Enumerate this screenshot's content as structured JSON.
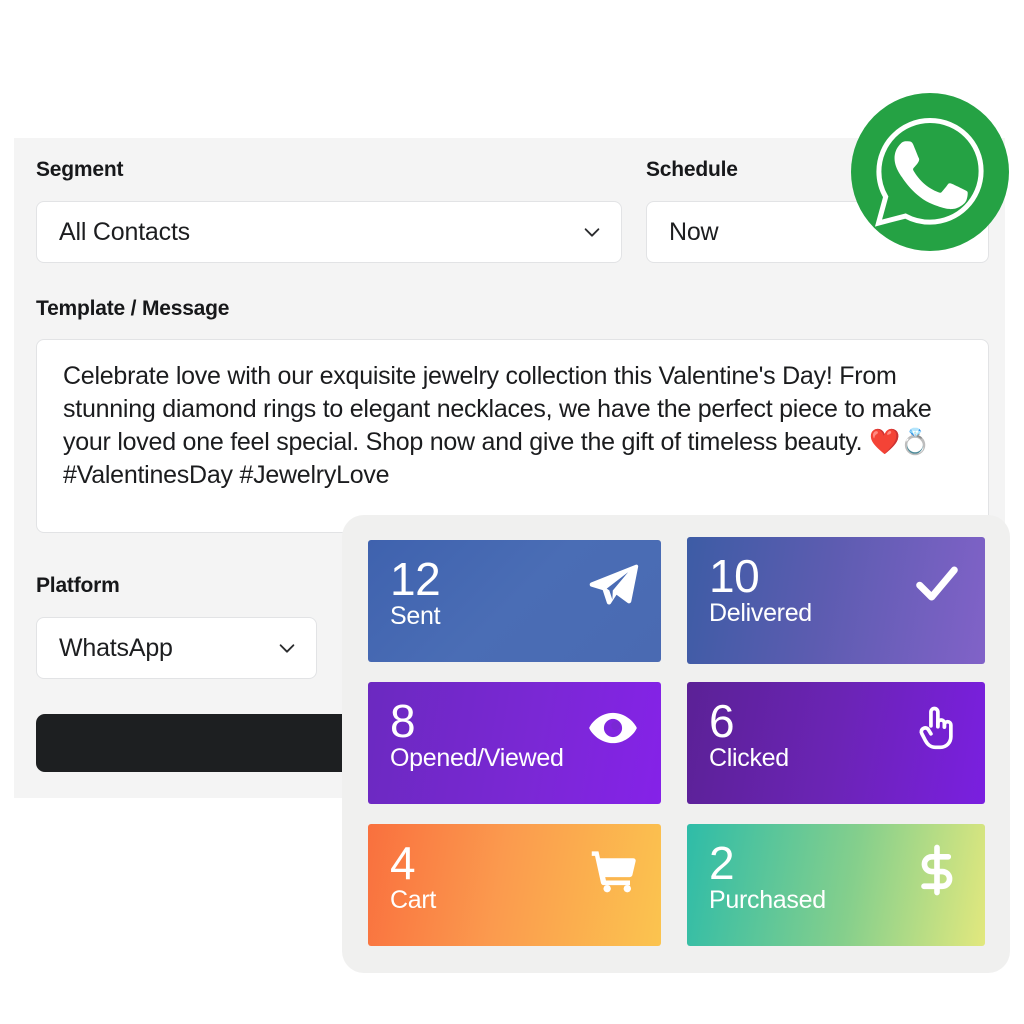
{
  "form": {
    "segment": {
      "label": "Segment",
      "value": "All Contacts",
      "chevron_icon": "chevron-down-icon"
    },
    "schedule": {
      "label": "Schedule",
      "value": "Now"
    },
    "message": {
      "label": "Template / Message",
      "value": "Celebrate love with our exquisite jewelry collection this Valentine's Day! From stunning diamond rings to elegant necklaces, we have the perfect piece to make your loved one feel special. Shop now and give the gift of timeless beauty. ❤️💍 #ValentinesDay #JewelryLove"
    },
    "platform": {
      "label": "Platform",
      "value": "WhatsApp",
      "chevron_icon": "chevron-down-icon"
    },
    "send_button": {
      "label": "",
      "background_color": "#1d1f21"
    },
    "panel_background": "#f4f4f4"
  },
  "branding": {
    "whatsapp_badge": {
      "icon": "whatsapp-icon",
      "circle_color": "#25a244",
      "glyph_color": "#ffffff"
    }
  },
  "metrics_overlay": {
    "background": "#f0f0ef",
    "cards": [
      {
        "value": "12",
        "label": "Sent",
        "icon": "paper-plane-icon",
        "color_start": "#3f62ae",
        "color_end": "#4a6ab2"
      },
      {
        "value": "10",
        "label": "Delivered",
        "icon": "check-icon",
        "color_start": "#3d5ca5",
        "color_end": "#8162c8"
      },
      {
        "value": "8",
        "label": "Opened/Viewed",
        "icon": "eye-icon",
        "color_start": "#6b29c0",
        "color_end": "#8522e8"
      },
      {
        "value": "6",
        "label": "Clicked",
        "icon": "pointing-hand-icon",
        "color_start": "#5b2196",
        "color_end": "#7a1fe0"
      },
      {
        "value": "4",
        "label": "Cart",
        "icon": "shopping-cart-icon",
        "color_start": "#f9703e",
        "color_end": "#fbc44f"
      },
      {
        "value": "2",
        "label": "Purchased",
        "icon": "dollar-sign-icon",
        "color_start": "#2ebca8",
        "color_end": "#e2e87e"
      }
    ]
  }
}
